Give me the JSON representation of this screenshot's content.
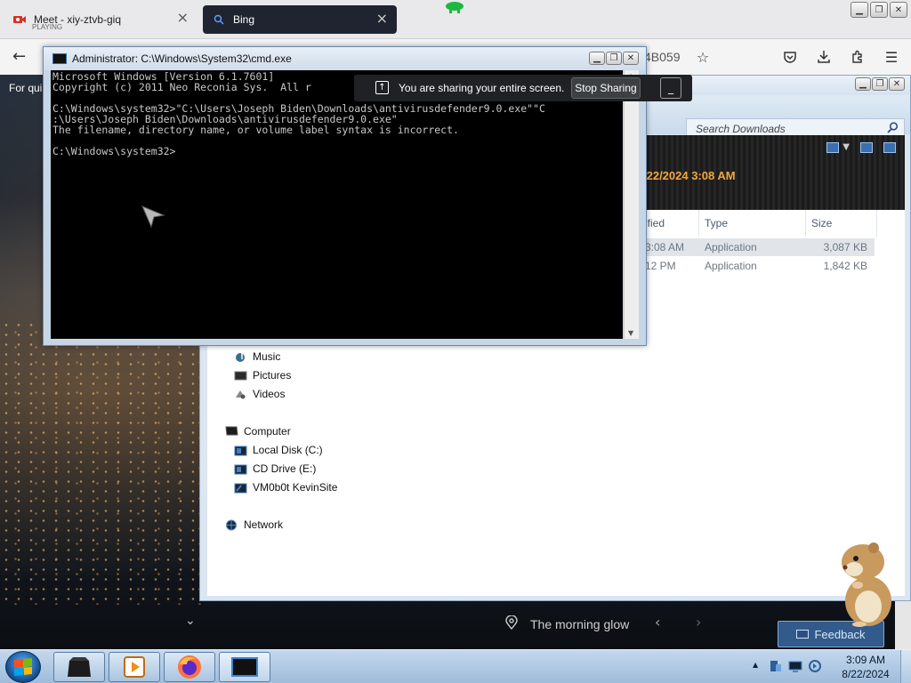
{
  "browser": {
    "tabs": [
      {
        "title": "Meet - xiy-ztvb-giq",
        "status": "PLAYING",
        "close": "×"
      },
      {
        "title": "Bing",
        "close": "×"
      }
    ],
    "url_fragment": "4B059",
    "quick_text": "For qui"
  },
  "share_bar": {
    "message": "You are sharing your entire screen.",
    "stop_label": "Stop Sharing",
    "minimize_label": "_"
  },
  "cmd": {
    "title": "Administrator: C:\\Windows\\System32\\cmd.exe",
    "lines": [
      "Microsoft Windows [Version 6.1.7601]",
      "Copyright (c) 2011 Neo Reconia Sys.  All r",
      "",
      "C:\\Windows\\system32>\"C:\\Users\\Joseph Biden\\Downloads\\antivirusdefender9.0.exe\"\"C",
      ":\\Users\\Joseph Biden\\Downloads\\antivirusdefender9.0.exe\"",
      "The filename, directory name, or volume label syntax is incorrect.",
      "",
      "C:\\Windows\\system32>"
    ],
    "text_color": "#c8c8c8",
    "bg_color": "#000000"
  },
  "explorer": {
    "search_placeholder": "Search Downloads",
    "banner_date": "/22/2024 3:08 AM",
    "columns": {
      "modified": "ified",
      "type": "Type",
      "size": "Size"
    },
    "files": [
      {
        "modified": "3:08 AM",
        "type": "Application",
        "size": "3,087 KB",
        "selected": true
      },
      {
        "modified": "12 PM",
        "type": "Application",
        "size": "1,842 KB",
        "selected": false
      }
    ],
    "nav": {
      "libraries": [
        "Music",
        "Pictures",
        "Videos"
      ],
      "computer": "Computer",
      "drives": [
        "Local Disk (C:)",
        "CD Drive (E:)",
        "VM0b0t KevinSite"
      ],
      "network": "Network"
    }
  },
  "bing_overlay": {
    "location_text": "The morning glow",
    "feedback_label": "Feedback"
  },
  "taskbar": {
    "time": "3:09 AM",
    "date": "8/22/2024"
  },
  "colors": {
    "accent_date": "#f4a640",
    "taskbar_top": "#c4d8ee",
    "share_bar_bg": "#202124"
  }
}
